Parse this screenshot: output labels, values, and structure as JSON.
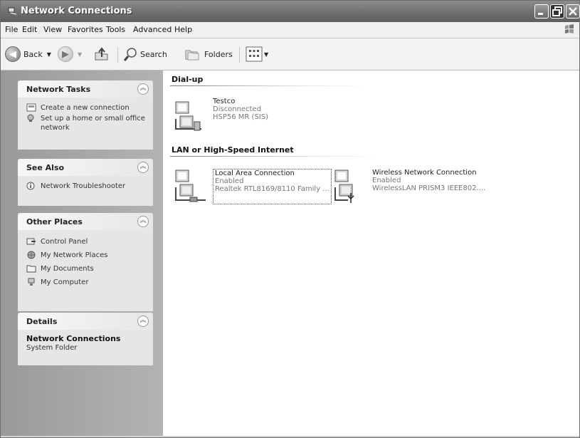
{
  "window": {
    "title": "Network Connections"
  },
  "menu": [
    "File",
    "Edit",
    "View",
    "Favorites",
    "Tools",
    "Advanced",
    "Help"
  ],
  "toolbar": {
    "back": "Back",
    "search": "Search",
    "folders": "Folders"
  },
  "sidebar": {
    "network_tasks": {
      "title": "Network Tasks",
      "items": [
        "Create a new connection",
        "Set up a home or small office network"
      ]
    },
    "see_also": {
      "title": "See Also",
      "items": [
        "Network Troubleshooter"
      ]
    },
    "other_places": {
      "title": "Other Places",
      "items": [
        "Control Panel",
        "My Network Places",
        "My Documents",
        "My Computer"
      ]
    },
    "details": {
      "title": "Details",
      "name": "Network Connections",
      "type": "System Folder"
    }
  },
  "groups": {
    "dialup": {
      "title": "Dial-up",
      "items": [
        {
          "name": "Testco",
          "status": "Disconnected",
          "device": "HSP56 MR (SIS)"
        }
      ]
    },
    "lan": {
      "title": "LAN or High-Speed Internet",
      "items": [
        {
          "name": "Local Area Connection",
          "status": "Enabled",
          "device": "Realtek RTL8169/8110 Family ..."
        },
        {
          "name": "Wireless Network Connection",
          "status": "Enabled",
          "device": "WirelessLAN PRISM3 IEEE802...."
        }
      ]
    }
  }
}
